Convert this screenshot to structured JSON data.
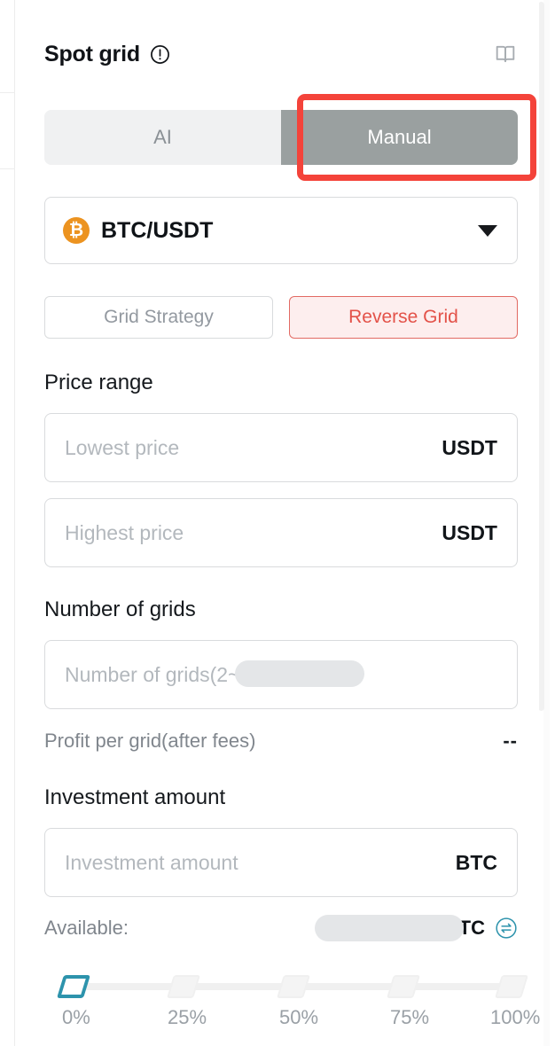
{
  "header": {
    "title": "Spot grid",
    "info_icon": "info-circle-icon",
    "book_icon": "open-book-icon"
  },
  "mode_tabs": {
    "items": [
      {
        "label": "AI",
        "active": false
      },
      {
        "label": "Manual",
        "active": true
      }
    ],
    "highlight_color": "#f4433a",
    "active_bg": "#9aa0a0",
    "inactive_bg": "#f0f1f2"
  },
  "pair_selector": {
    "symbol": "BTC/USDT",
    "coin_glyph": "₿",
    "coin_color": "#ec9320",
    "caret_icon": "chevron-down-icon"
  },
  "strategy_buttons": [
    {
      "label": "Grid Strategy",
      "active": false
    },
    {
      "label": "Reverse Grid",
      "active": true,
      "color": "#e35249",
      "bg": "#fdeeee"
    }
  ],
  "price_range": {
    "heading": "Price range",
    "lowest": {
      "value": "",
      "placeholder": "Lowest price",
      "unit": "USDT"
    },
    "highest": {
      "value": "",
      "placeholder": "Highest price",
      "unit": "USDT"
    }
  },
  "number_of_grids": {
    "heading": "Number of grids",
    "input": {
      "value": "",
      "placeholder": "Number of grids(2~200)"
    },
    "profit_label": "Profit per grid(after fees)",
    "profit_value": "--"
  },
  "investment": {
    "heading": "Investment amount",
    "input": {
      "value": "",
      "placeholder": "Investment amount",
      "unit": "BTC"
    },
    "available_label": "Available:",
    "available_value": "",
    "available_unit": "BTC",
    "swap_icon": "swap-transfer-icon",
    "swap_color": "#2d93ac"
  },
  "percent_slider": {
    "current": "0%",
    "ticks": [
      "0%",
      "25%",
      "50%",
      "75%",
      "100%"
    ],
    "active_color": "#2d93ac",
    "rail_color": "#f0f0f0"
  }
}
